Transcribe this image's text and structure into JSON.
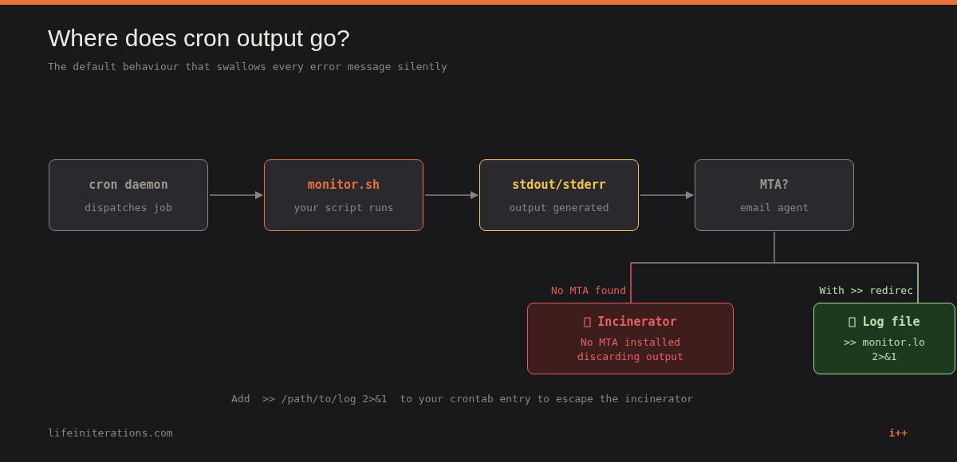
{
  "title": "Where does cron output go?",
  "subtitle": "The default behaviour that swallows every error message silently",
  "nodes": [
    {
      "kind": "neutral",
      "title": "cron daemon",
      "detail": "dispatches job"
    },
    {
      "kind": "accent",
      "title": "monitor.sh",
      "detail": "your script runs"
    },
    {
      "kind": "warning",
      "title": "stdout/stderr",
      "detail": "output generated"
    },
    {
      "kind": "neutral",
      "title": "MTA?",
      "detail": "email agent"
    }
  ],
  "branches": [
    {
      "kind": "danger",
      "label": "No MTA found",
      "title": "Incinerator",
      "lines": [
        "No MTA installed",
        "discarding output"
      ]
    },
    {
      "kind": "success",
      "label": "With >> redirec",
      "title": "Log file",
      "lines": [
        ">> monitor.lo",
        "2>&1"
      ]
    }
  ],
  "tip": "Add  >> /path/to/log 2>&1  to your crontab entry to escape the incinerator",
  "footer": {
    "site": "lifeiniterations.com",
    "logo": "i++"
  }
}
